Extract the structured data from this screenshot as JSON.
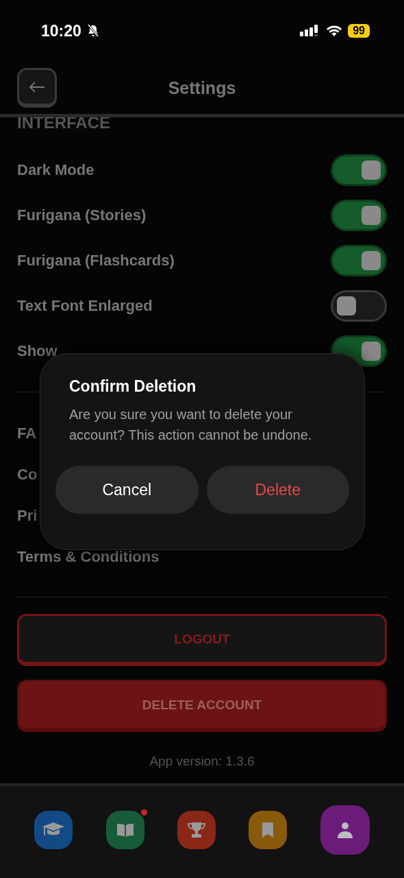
{
  "status_bar": {
    "time": "10:20",
    "battery": "99"
  },
  "header": {
    "title": "Settings"
  },
  "section_title": "INTERFACE",
  "toggles": [
    {
      "label": "Dark Mode",
      "on": true
    },
    {
      "label": "Furigana (Stories)",
      "on": true
    },
    {
      "label": "Furigana (Flashcards)",
      "on": true
    },
    {
      "label": "Text Font Enlarged",
      "on": false
    },
    {
      "label": "Show",
      "on": true
    }
  ],
  "links": [
    "FA",
    "Co",
    "Pri",
    "Terms & Conditions"
  ],
  "logout_button": "LOGOUT",
  "delete_account_button": "DELETE ACCOUNT",
  "app_version": "App version: 1.3.6",
  "dialog": {
    "title": "Confirm Deletion",
    "message": "Are you sure you want to delete your account? This action cannot be undone.",
    "buttons": [
      {
        "label": "Cancel",
        "kind": "cancel"
      },
      {
        "label": "Delete",
        "kind": "destructive"
      }
    ]
  },
  "tab_bar": [
    {
      "kind": "learn",
      "color": "#134a85",
      "selected": false,
      "badge": false
    },
    {
      "kind": "read",
      "color": "#165c3a",
      "selected": false,
      "badge": true
    },
    {
      "kind": "trophy",
      "color": "#8a2716",
      "selected": false,
      "badge": false
    },
    {
      "kind": "bookmark",
      "color": "#8a5a0c",
      "selected": false,
      "badge": false
    },
    {
      "kind": "profile",
      "color": "#6b1c7a",
      "selected": true,
      "badge": false
    }
  ]
}
